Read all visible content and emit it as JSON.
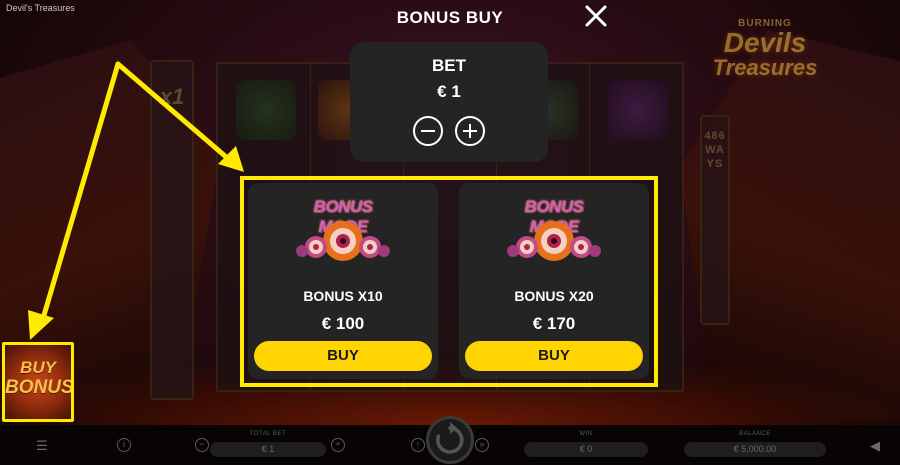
{
  "window": {
    "title": "Devil's Treasures"
  },
  "background": {
    "logo": {
      "line1": "BURNING",
      "line2": "Devils",
      "line3": "Treasures"
    },
    "multiplier_label": "x1",
    "ways_text": "486 WAYS"
  },
  "buy_bonus_button": {
    "line1": "BUY",
    "line2": "BONUS"
  },
  "modal": {
    "title": "BONUS BUY",
    "close_icon": "close-icon",
    "bet": {
      "label": "BET",
      "value": "€ 1"
    },
    "offers": [
      {
        "art_label": "BONUS MODE",
        "name": "BONUS X10",
        "price": "€ 100",
        "button": "BUY"
      },
      {
        "art_label": "BONUS MODE",
        "name": "BONUS X20",
        "price": "€ 170",
        "button": "BUY"
      }
    ]
  },
  "toolbar": {
    "total_bet_label": "TOTAL BET",
    "total_bet_value": "€ 1",
    "win_label": "WIN",
    "win_value": "€ 0",
    "balance_label": "BALANCE",
    "balance_value": "€ 5,000.00"
  },
  "colors": {
    "highlight": "#ffea00",
    "buy_button": "#ffd400",
    "panel": "#242424"
  }
}
